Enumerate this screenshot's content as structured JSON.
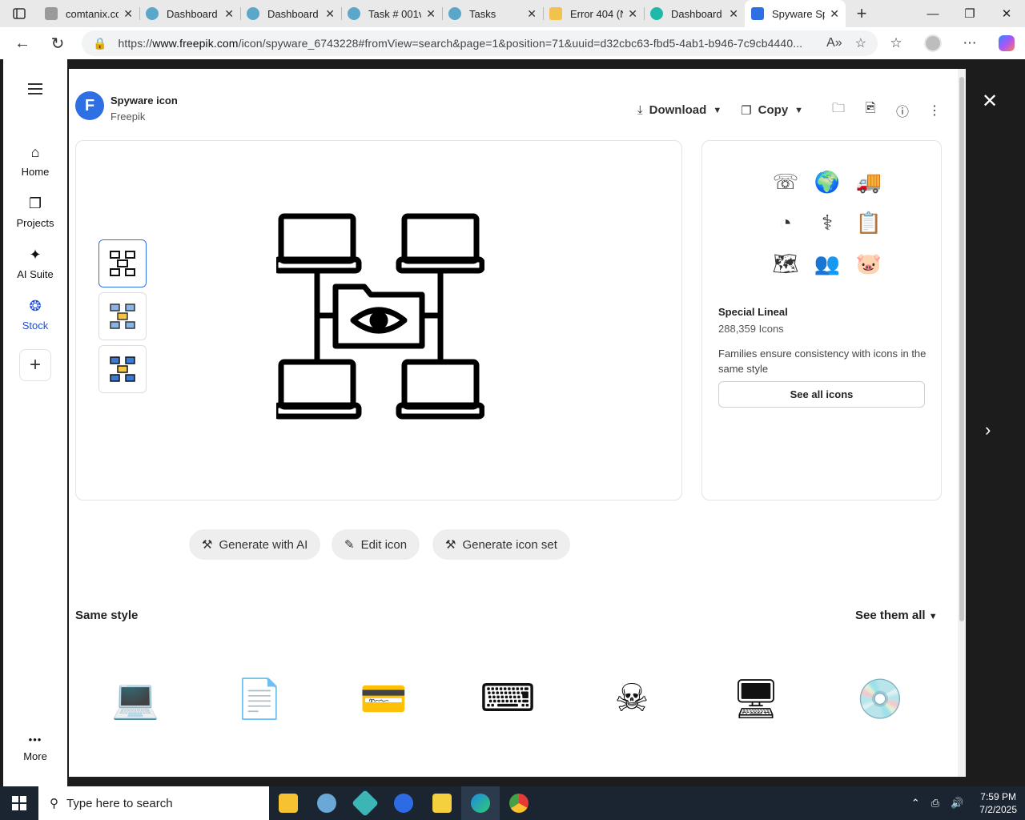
{
  "browser": {
    "tabs": [
      {
        "title": "comtanix.com",
        "color": "#777777"
      },
      {
        "title": "Dashboard",
        "color": "#5aa7c9"
      },
      {
        "title": "Dashboard",
        "color": "#5aa7c9"
      },
      {
        "title": "Task # 001v",
        "color": "#5aa7c9"
      },
      {
        "title": "Tasks",
        "color": "#5aa7c9"
      },
      {
        "title": "Error 404 (N",
        "color": "#f2c14e"
      },
      {
        "title": "Dashboard",
        "color": "#1fb9a9"
      },
      {
        "title": "Spyware Sp",
        "color": "#2f6fe4"
      }
    ],
    "url_prefix": "https://",
    "url_domain": "www.freepik.com",
    "url_path": "/icon/spyware_6743228#fromView=search&page=1&position=71&uuid=d32cbc63-fbd5-4ab1-b946-7c9cb4440..."
  },
  "nav": {
    "items": [
      {
        "label": "Home",
        "icon": "⌂"
      },
      {
        "label": "Projects",
        "icon": "❐"
      },
      {
        "label": "AI Suite",
        "icon": "✦"
      },
      {
        "label": "Stock",
        "icon": "❂"
      }
    ],
    "add": "+",
    "more": "More",
    "more_icon": "•••"
  },
  "header": {
    "logo_letter": "F",
    "title": "Spyware icon",
    "author": "Freepik",
    "download_label": "Download",
    "copy_label": "Copy"
  },
  "family": {
    "icons": [
      "☏",
      "🌍",
      "🚚",
      "◔",
      "⚕",
      "📋",
      "🗺",
      "👥",
      "🐷"
    ],
    "name": "Special Lineal",
    "count": "288,359 Icons",
    "description": "Families ensure consistency with icons in the same style",
    "button": "See all icons"
  },
  "actions": {
    "generate_ai": "Generate with AI",
    "edit_icon": "Edit icon",
    "generate_set": "Generate icon set"
  },
  "same_style": {
    "title": "Same style",
    "see_all": "See them all",
    "icons": [
      "💻",
      "📄",
      "💳",
      "⌨",
      "☠",
      "🖥",
      "💿"
    ]
  },
  "taskbar": {
    "search_placeholder": "Type here to search",
    "time": "7:59 PM",
    "date": "7/2/2025",
    "apps": [
      "#f6c231",
      "#6aa8d8",
      "#3bb5b5",
      "#2d6be4",
      "#f4d03f",
      "#1e88e5",
      "#e53935"
    ]
  },
  "colors": {
    "accent": "#2f6fe4",
    "stock_active": "#1d4ed8"
  }
}
